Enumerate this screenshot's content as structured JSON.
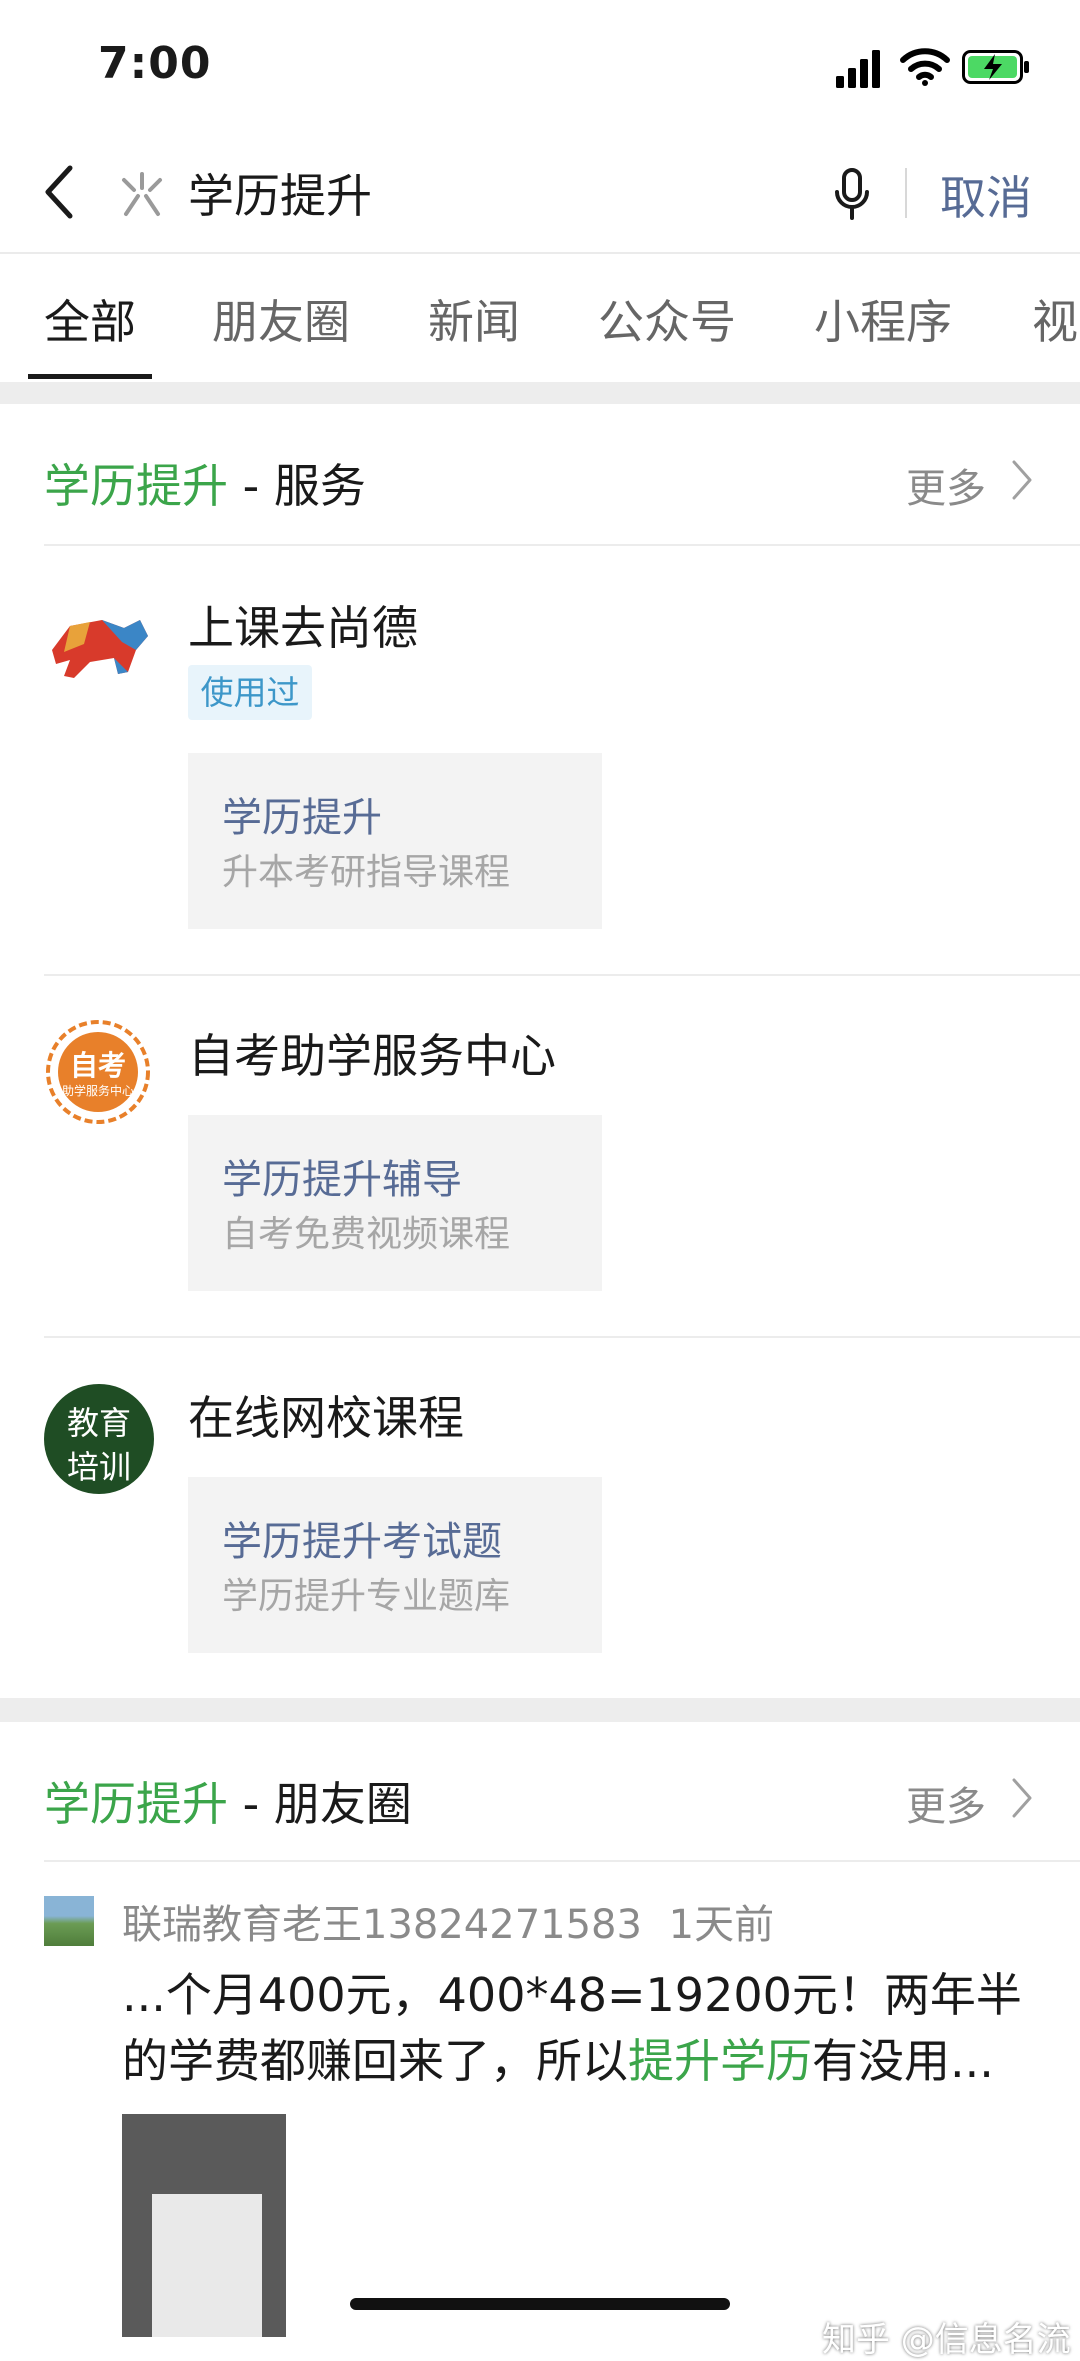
{
  "status": {
    "time": "7:00"
  },
  "search": {
    "query": "学历提升",
    "cancel_label": "取消"
  },
  "tabs": [
    "全部",
    "朋友圈",
    "新闻",
    "公众号",
    "小程序",
    "视"
  ],
  "services": {
    "title_highlight": "学历提升",
    "title_rest": " - 服务",
    "more_label": "更多",
    "items": [
      {
        "name": "上课去尚德",
        "badge": "使用过",
        "card_title": "学历提升",
        "card_sub": "升本考研指导课程",
        "logo": "bull-logo"
      },
      {
        "name": "自考助学服务中心",
        "card_title": "学历提升辅导",
        "card_sub": "自考免费视频课程",
        "logo": "laurel-logo",
        "logo_text_main": "自考",
        "logo_text_sub": "助学服务中心"
      },
      {
        "name": "在线网校课程",
        "card_title": "学历提升考试题",
        "card_sub": "学历提升专业题库",
        "logo": "circle-logo",
        "logo_text_1": "教育",
        "logo_text_2": "培训"
      }
    ]
  },
  "moments": {
    "title_highlight": "学历提升",
    "title_rest": " - 朋友圈",
    "more_label": "更多",
    "post": {
      "user": "联瑞教育老王13824271583",
      "time": "1天前",
      "text_before": "...个月400元，400*48=19200元！两年半的学费都赚回来了，所以",
      "text_highlight": "提升学历",
      "text_after": "有没用..."
    }
  },
  "watermark": "知乎 @信息名流",
  "colors": {
    "accent_green": "#3ba54a",
    "link_blue": "#576b95",
    "badge_blue": "#3d97c9"
  }
}
